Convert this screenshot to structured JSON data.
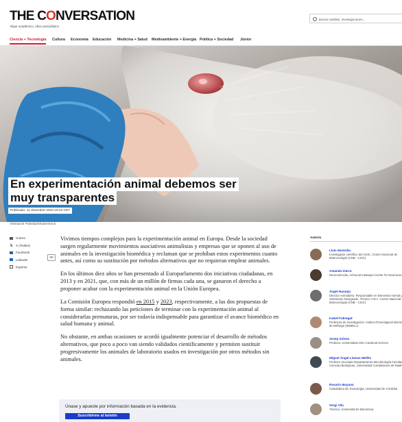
{
  "header": {
    "logo_prefix": "THE C",
    "logo_o": "O",
    "logo_suffix": "NVERSATION",
    "tagline": "Rigor académico, oficio periodístico",
    "search_placeholder": "Buscar análisis, investigaciones..."
  },
  "nav": [
    {
      "label": "Ciencia + Tecnología",
      "active": true
    },
    {
      "label": "Cultura"
    },
    {
      "label": "Economía"
    },
    {
      "label": "Educación"
    },
    {
      "label": "Medicina + Salud"
    },
    {
      "label": "Medioambiente + Energía"
    },
    {
      "label": "Política + Sociedad"
    },
    {
      "label": "Júnior"
    }
  ],
  "article": {
    "title_line1": "En experimentación animal debemos ser",
    "title_line2": "muy transparentes",
    "published": "Publicado: 11 diciembre 2023 20:24 CET",
    "image_credit": "Aleksandr Pobeda/Shutterstock",
    "p1": "Vivimos tiempos complejos para la experimentación animal en Europa. Desde la sociedad surgen regularmente movimientos asociativos animalistas y empresas que se oponen al uso de animales en la investigación biomédica y reclaman que se prohíban estos experimentos cuanto antes, así como su sustitución por métodos alternativos que no requieran emplear animales.",
    "p2": "En los últimos diez años se han presentado al Europarlamento dos iniciativas ciudadanas, en 2013 y en 2021, que, con más de un millón de firmas cada una, se ganaron el derecho a proponer acabar con la experimentación animal en la Unión Europea.",
    "p3_before": "La Comisión Europea respondió ",
    "p3_link1": "en 2015",
    "p3_mid": " y ",
    "p3_link2": "2023",
    "p3_after": ", respectivamente, a las dos propuestas de forma similar: rechazando las peticiones de terminar con la experimentación animal al considerarlas prematuras, por ser todavía indispensable para garantizar el avance biomédico en salud humana y animal.",
    "p4": "No obstante, en ambas ocasiones se acordó igualmente potenciar el desarrollo de métodos alternativos, que poco a poco van siendo validados científicamente y permiten sustituir progresivamente los animales de laboratorio usados en investigación por otros métodos sin animales."
  },
  "share": {
    "items": [
      {
        "icon": "email-icon",
        "label": "Correo"
      },
      {
        "icon": "x-icon",
        "label": "X (Twitter)"
      },
      {
        "icon": "facebook-icon",
        "label": "Facebook"
      },
      {
        "icon": "linkedin-icon",
        "label": "LinkedIn"
      },
      {
        "icon": "printer-icon",
        "label": "Imprimir"
      }
    ],
    "count": "60"
  },
  "cta": {
    "text": "Únase y apueste por información basada en la evidencia.",
    "button": "Suscribirme al boletín"
  },
  "authors": {
    "heading": "Autoría",
    "list": [
      {
        "name": "Lluís Montoliu",
        "role": "Investigador científico del CSIC, Centro Nacional de Biotecnología (CNB - CSIC)"
      },
      {
        "name": "Amanda Sierra",
        "role": "Neurociencias, Achucarro Basque Center for Neuroscience"
      },
      {
        "name": "Ángel Naranjo",
        "role": "Director Animalario. Responsable en Bienestar Animal y Veterinario Designado. Técnico I+D+i. Centro Nacional de Biotecnología (CNB - CSIC)"
      },
      {
        "name": "Isabel Fabregat",
        "role": "Profesora de Investigación. Institut d'Investigació Biomèdica de Bellvitge (IDIBELL)"
      },
      {
        "name": "Josep Solves",
        "role": "Profesor, Universidad CEU Cardenal Herrera"
      },
      {
        "name": "Miguel Ángel Llamas Mellés",
        "role": "Profesor Asociado Departamento Microbiología Facultad Ciencias Biológicas, Universidad Complutense de Madrid"
      },
      {
        "name": "Rosario Moyano",
        "role": "Catedrática de Toxicología, Universidad de Córdoba"
      },
      {
        "name": "Sergi Vila",
        "role": "Técnico, Universitat de Barcelona"
      }
    ]
  },
  "colors": {
    "brand_red": "#d8352a",
    "nav_active": "#c41e3a",
    "link_blue": "#1a3cc9",
    "cta_bg": "#eef0f5"
  }
}
